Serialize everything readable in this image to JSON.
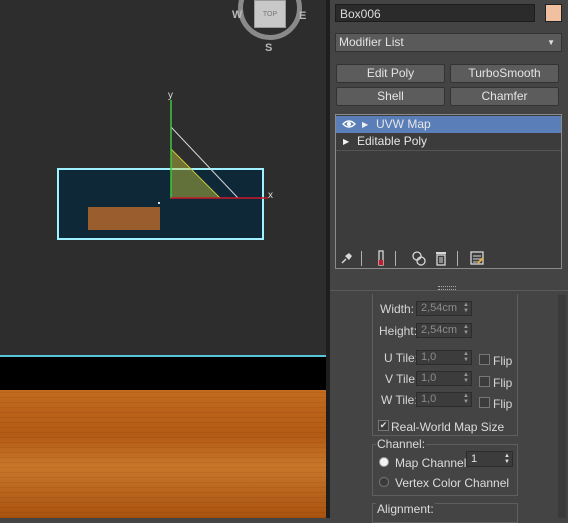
{
  "viewport": {
    "viewcube_face": "TOP",
    "compass": {
      "west": "W",
      "east": "E",
      "south": "S"
    },
    "gizmo": {
      "x_label": "x",
      "y_label": "y"
    },
    "colors": {
      "background": "#2d2d2d",
      "selection_outline": "#9ef2ff",
      "box_fill": "#0f2838",
      "wood_object": "#9a5d2e",
      "gizmo_x": "#c8182a",
      "gizmo_y": "#3cc83c",
      "gizmo_plane": "#c8c83c",
      "floor_wood": "#c26a1f"
    }
  },
  "panel": {
    "object_name": "Box006",
    "object_color": "#f0c0a0",
    "modifier_list_label": "Modifier List",
    "modifier_list_icon": "chevron-down-icon",
    "buttons": [
      "Edit Poly",
      "TurboSmooth",
      "Shell",
      "Chamfer"
    ],
    "stack": [
      {
        "label": "UVW Map",
        "selected": true,
        "visible_icon": "eye-icon"
      },
      {
        "label": "Editable Poly",
        "selected": false
      }
    ],
    "stack_tools": [
      "pin-stack-icon",
      "show-end-result-icon",
      "make-unique-icon",
      "remove-modifier-icon",
      "configure-modifier-sets-icon"
    ],
    "params": {
      "width_label": "Width:",
      "width_value": "2,54cm",
      "height_label": "Height:",
      "height_value": "2,54cm",
      "u_tile_label": "U Tile:",
      "u_tile_value": "1,0",
      "v_tile_label": "V Tile:",
      "v_tile_value": "1,0",
      "w_tile_label": "W Tile:",
      "w_tile_value": "1,0",
      "flip_label": "Flip",
      "real_world_label": "Real-World Map Size",
      "real_world_checked": true
    },
    "channel": {
      "group_label": "Channel:",
      "map_channel_label": "Map Channel:",
      "map_channel_value": "1",
      "vertex_color_label": "Vertex Color Channel",
      "selected": "map_channel"
    },
    "alignment": {
      "group_label": "Alignment:"
    }
  }
}
